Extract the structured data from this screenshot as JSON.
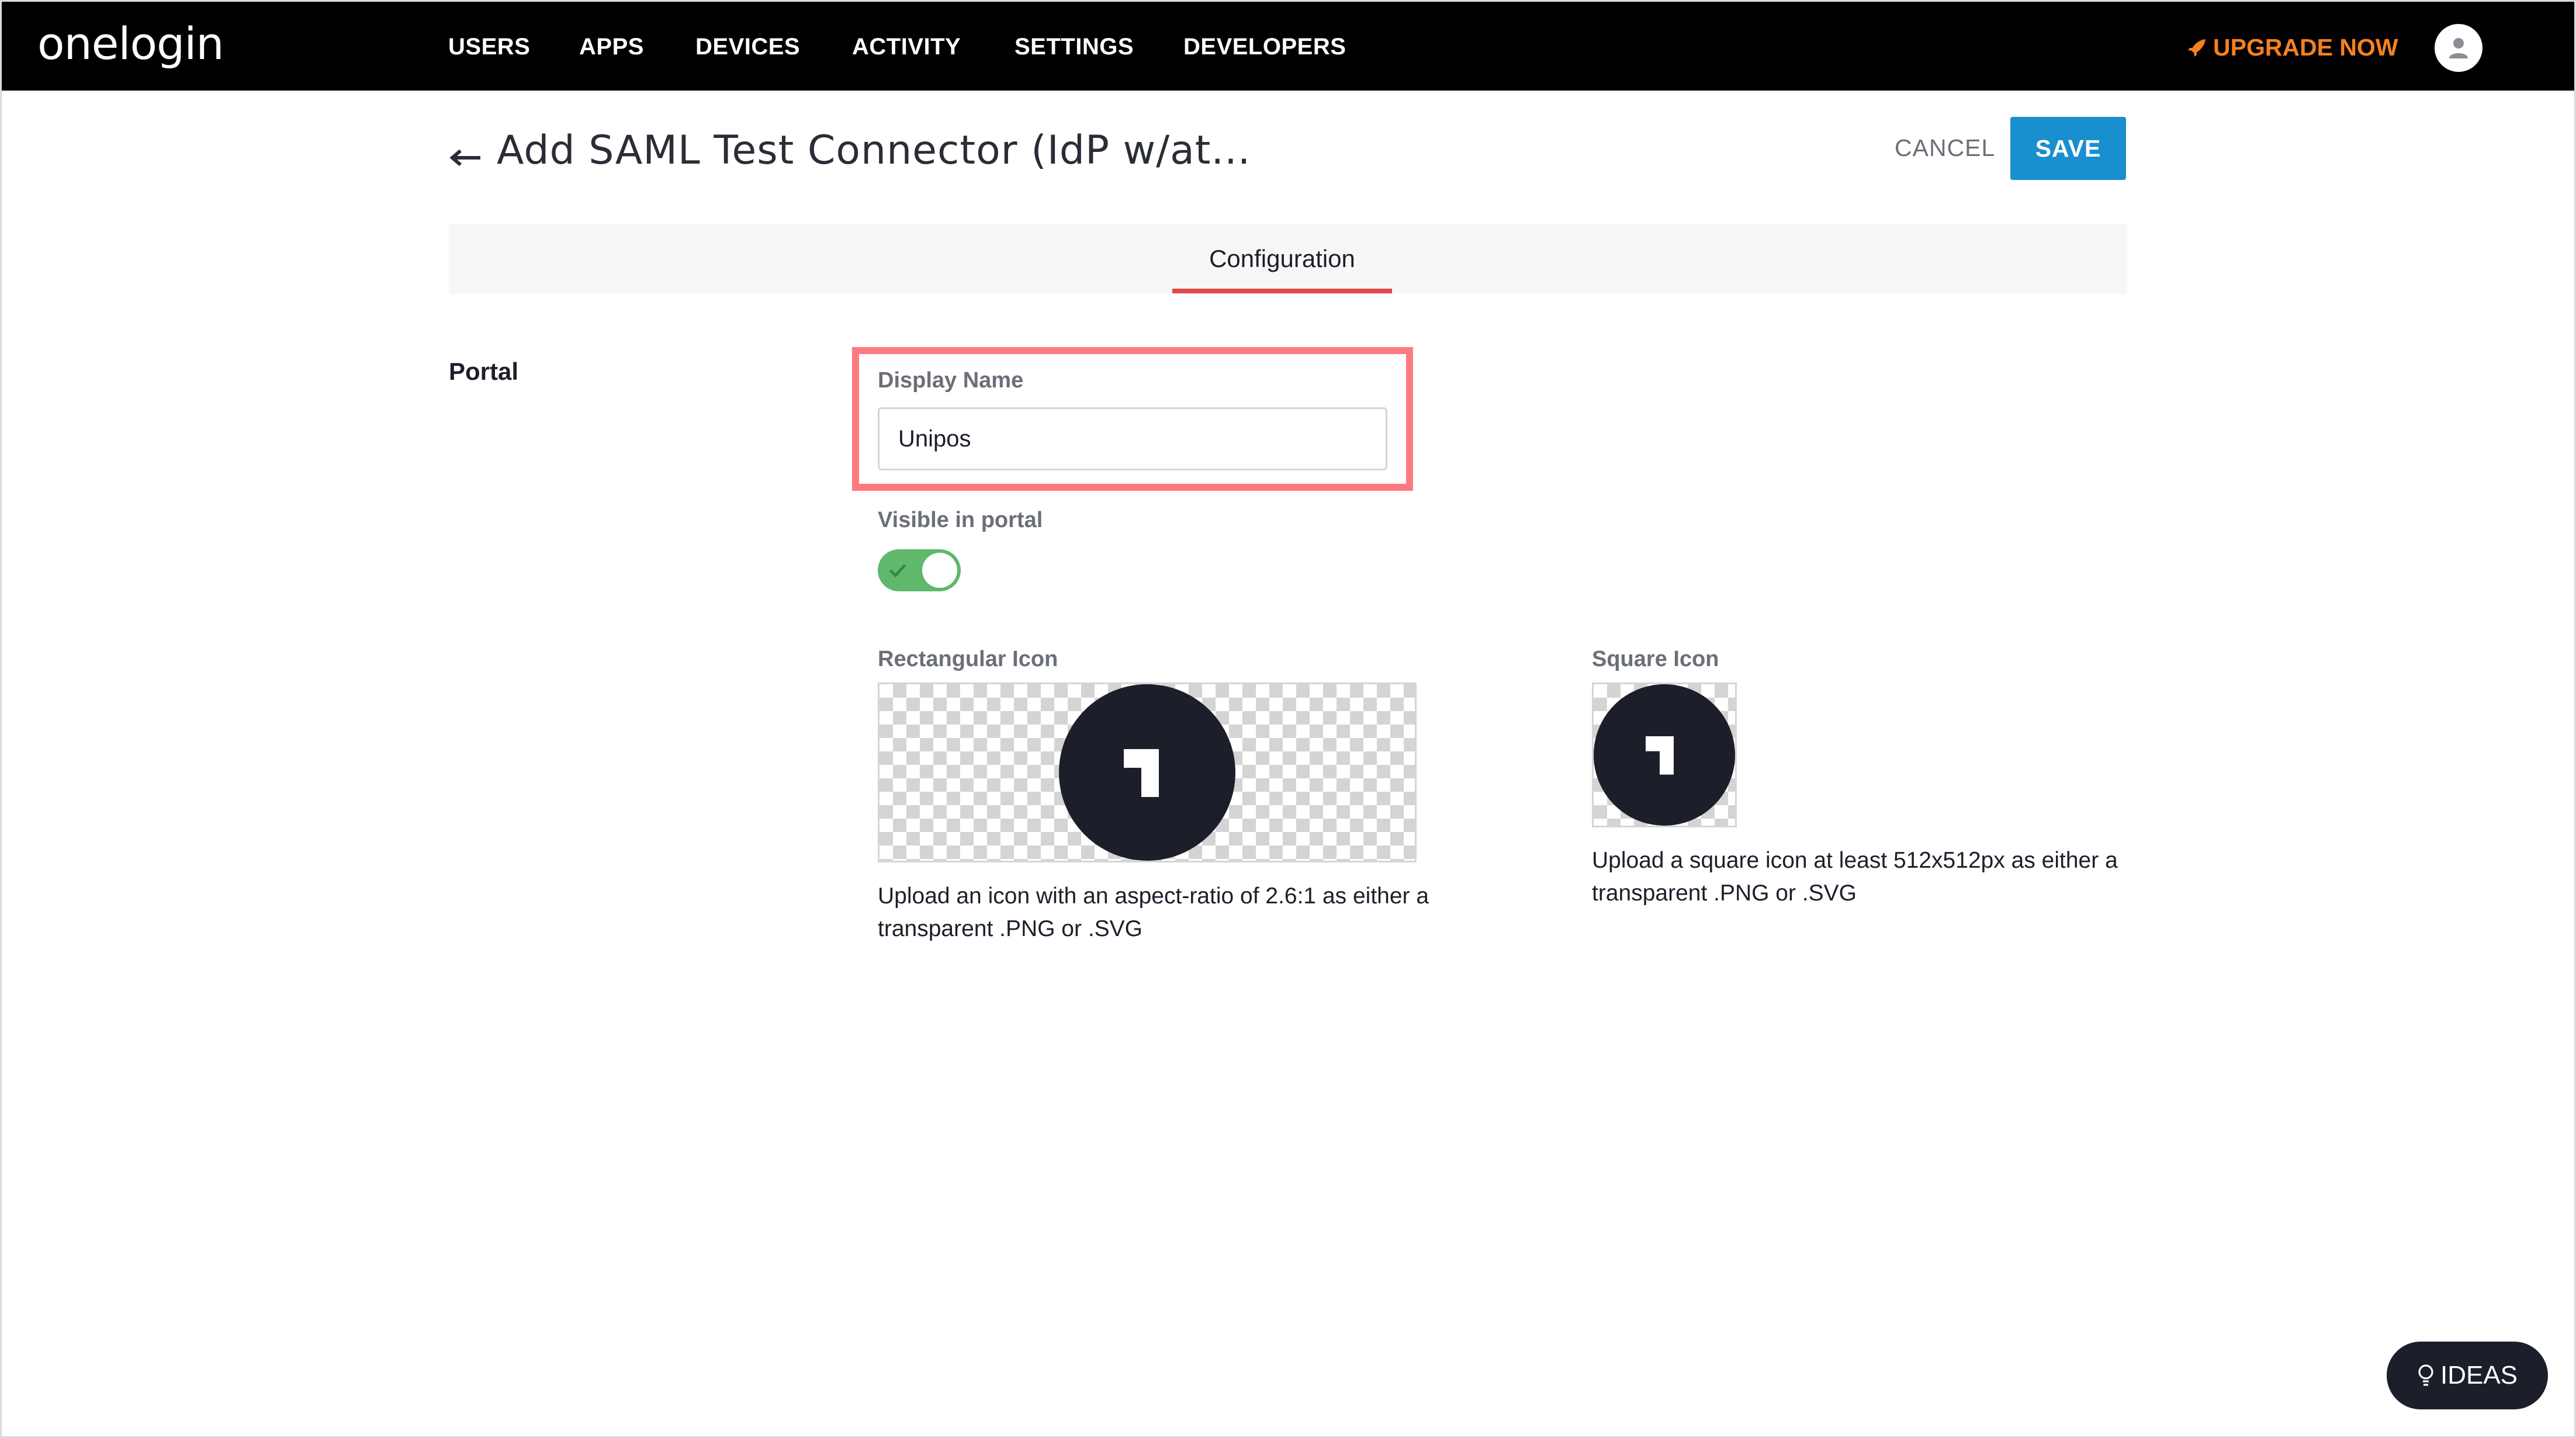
{
  "app": {
    "logo_text": "onelogin"
  },
  "nav": {
    "items": [
      {
        "label": "USERS"
      },
      {
        "label": "APPS"
      },
      {
        "label": "DEVICES"
      },
      {
        "label": "ACTIVITY"
      },
      {
        "label": "SETTINGS"
      },
      {
        "label": "DEVELOPERS"
      }
    ],
    "upgrade_label": "UPGRADE NOW",
    "upgrade_icon": "rocket-icon",
    "avatar_icon": "user-icon"
  },
  "header": {
    "back_icon": "arrow-left-icon",
    "title": "Add SAML Test Connector (IdP w/at...",
    "cancel_label": "CANCEL",
    "save_label": "SAVE"
  },
  "tabs": [
    {
      "label": "Configuration",
      "active": true
    }
  ],
  "portal": {
    "section_label": "Portal",
    "display_name": {
      "label": "Display Name",
      "value": "Unipos"
    },
    "visible_in_portal": {
      "label": "Visible in portal",
      "on": true
    },
    "rectangular_icon": {
      "label": "Rectangular Icon",
      "help": "Upload an icon with an aspect-ratio of 2.6:1 as either a transparent .PNG or .SVG"
    },
    "square_icon": {
      "label": "Square Icon",
      "help": "Upload a square icon at least 512x512px as either a transparent .PNG or .SVG"
    }
  },
  "ideas": {
    "label": "IDEAS",
    "icon": "lightbulb-icon"
  },
  "colors": {
    "nav_bg": "#000000",
    "upgrade": "#f5811f",
    "save": "#1a8fcf",
    "tab_underline": "#e0484a",
    "highlight": "#fc7a7f",
    "toggle_on": "#5fb86b"
  }
}
